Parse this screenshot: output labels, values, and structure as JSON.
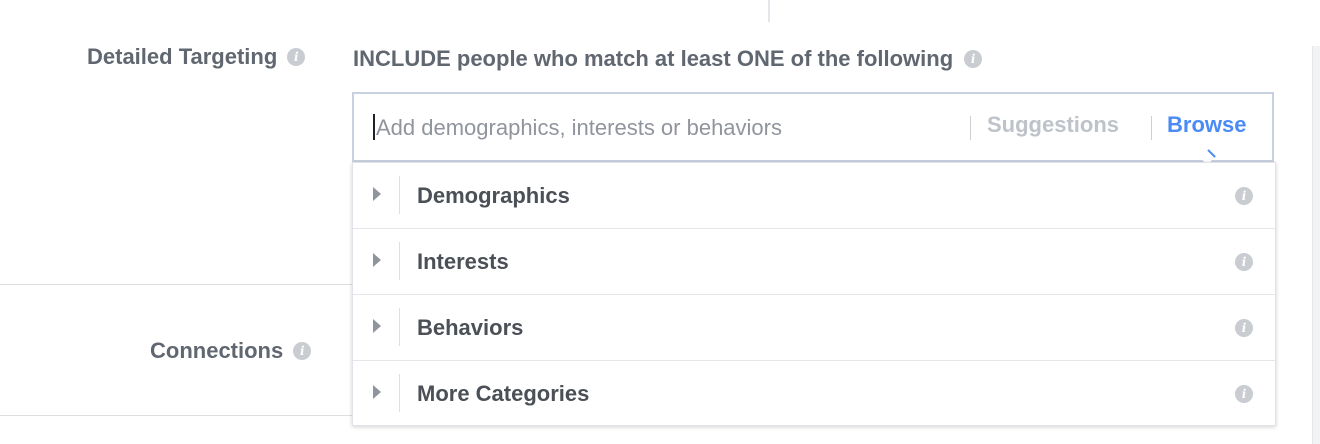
{
  "detailed_targeting": {
    "label": "Detailed Targeting",
    "include_title": "INCLUDE people who match at least ONE of the following",
    "search": {
      "placeholder": "Add demographics, interests or behaviors",
      "value": ""
    },
    "suggestions_label": "Suggestions",
    "browse_label": "Browse",
    "categories": [
      {
        "label": "Demographics"
      },
      {
        "label": "Interests"
      },
      {
        "label": "Behaviors"
      },
      {
        "label": "More Categories"
      }
    ]
  },
  "connections": {
    "label": "Connections"
  },
  "colors": {
    "browse_active": "#4a8bf5",
    "suggestions_inactive": "#bec3c9",
    "info_icon": "#c9ccd1"
  },
  "icons": {
    "info": "info-icon",
    "expand": "caret-right-icon"
  }
}
